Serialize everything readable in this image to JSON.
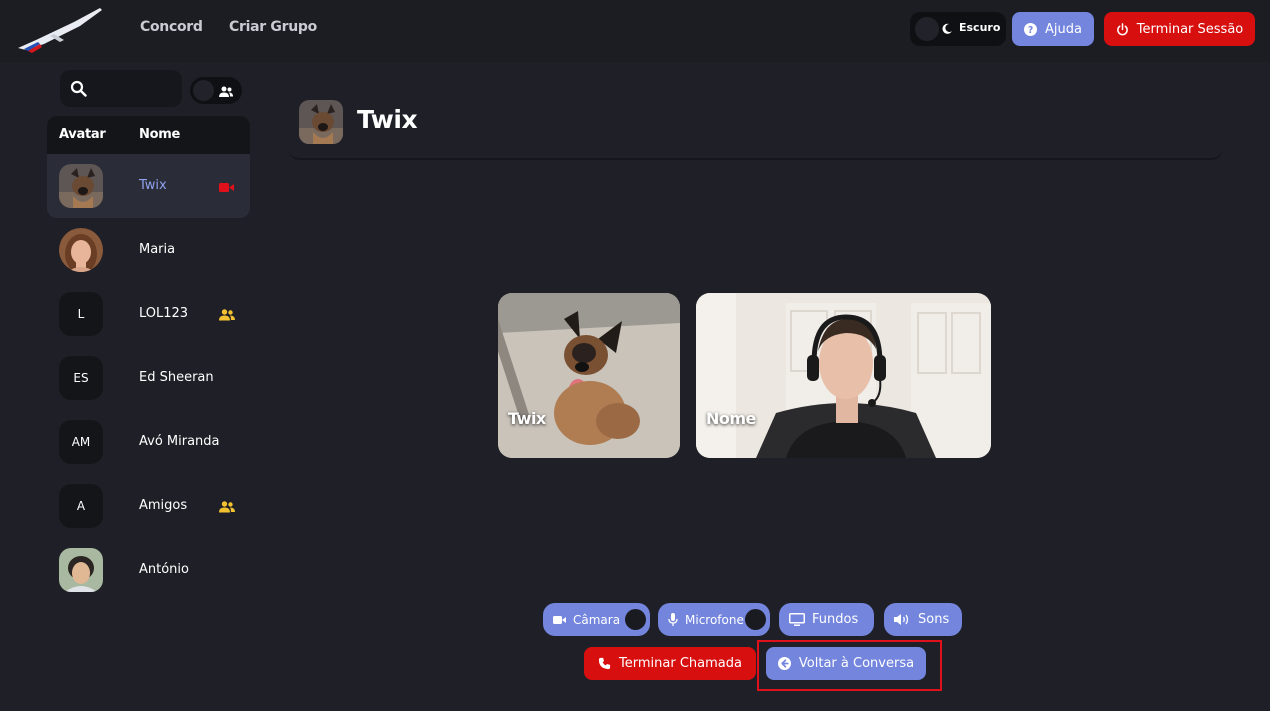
{
  "header": {
    "nav": [
      "Concord",
      "Criar Grupo"
    ],
    "theme_label": "Escuro",
    "help_label": "Ajuda",
    "logout_label": "Terminar Sessão"
  },
  "sidebar": {
    "search": {
      "value": "",
      "placeholder": ""
    },
    "columns": [
      "Avatar",
      "Nome"
    ],
    "contacts": [
      {
        "name": "Twix",
        "avatar": "photo-dog",
        "status_icon": "video-camera-icon",
        "active": true
      },
      {
        "name": "Maria",
        "avatar": "photo-woman"
      },
      {
        "name": "LOL123",
        "avatar": "L",
        "status_icon": "group-icon"
      },
      {
        "name": "Ed Sheeran",
        "avatar": "ES"
      },
      {
        "name": "Avó Miranda",
        "avatar": "AM"
      },
      {
        "name": "Amigos",
        "avatar": "A",
        "status_icon": "group-icon"
      },
      {
        "name": "António",
        "avatar": "photo-man"
      }
    ]
  },
  "chat": {
    "title": "Twix"
  },
  "call": {
    "participants": [
      "Twix",
      "Nome"
    ],
    "controls": {
      "camera": "Câmara",
      "microphone": "Microfone",
      "backgrounds": "Fundos",
      "sounds": "Sons",
      "end_call": "Terminar Chamada",
      "back": "Voltar à Conversa"
    }
  },
  "colors": {
    "accent": "#7385dd",
    "danger": "#d80f0f",
    "background": "#1f2027",
    "group_icon": "#f2c230",
    "video_icon": "#e0111a"
  }
}
